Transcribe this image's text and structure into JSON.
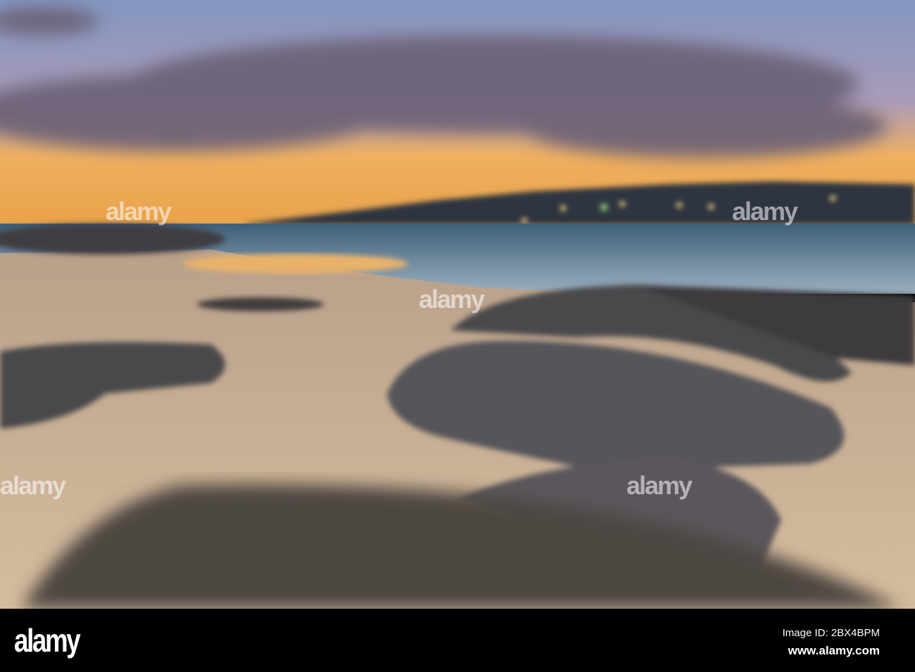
{
  "watermark": {
    "logo": "alamy",
    "image_id": "Image ID: 2BX4BPM",
    "url": "www.alamy.com"
  },
  "colors": {
    "sky_top": "#8fa0c4",
    "sunset": "#f4b24a",
    "cloud": "#6e6478",
    "sand": "#cdb297",
    "sea": "#4e6f86",
    "rock": "#4a4a4e"
  }
}
